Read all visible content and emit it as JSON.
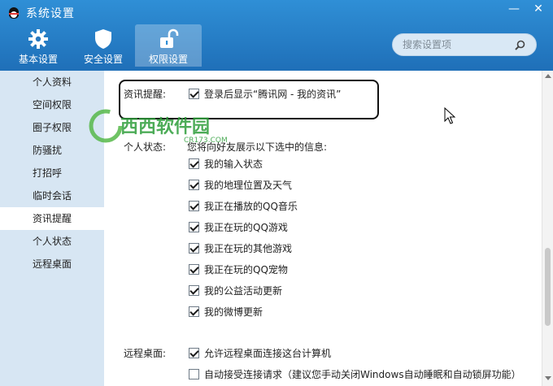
{
  "window": {
    "title": "系统设置",
    "min_glyph": "—",
    "close_glyph": "✕"
  },
  "tabs": [
    {
      "label": "基本设置",
      "icon": "gear-icon"
    },
    {
      "label": "安全设置",
      "icon": "shield-icon"
    },
    {
      "label": "权限设置",
      "icon": "unlock-icon",
      "active": true
    }
  ],
  "search": {
    "placeholder": "搜索设置项"
  },
  "sidebar": {
    "items": [
      {
        "label": "个人资料"
      },
      {
        "label": "空间权限"
      },
      {
        "label": "圈子权限"
      },
      {
        "label": "防骚扰"
      },
      {
        "label": "打招呼"
      },
      {
        "label": "临时会话"
      },
      {
        "label": "资讯提醒",
        "active": true
      },
      {
        "label": "个人状态"
      },
      {
        "label": "远程桌面"
      }
    ]
  },
  "news": {
    "label": "资讯提醒:",
    "option": {
      "text": "登录后显示“腾讯网 - 我的资讯”",
      "checked": true
    }
  },
  "status": {
    "label": "个人状态:",
    "intro": "您将向好友展示以下选中的信息:",
    "options": [
      {
        "text": "我的输入状态",
        "checked": true
      },
      {
        "text": "我的地理位置及天气",
        "checked": true
      },
      {
        "text": "我正在播放的QQ音乐",
        "checked": true
      },
      {
        "text": "我正在玩的QQ游戏",
        "checked": true
      },
      {
        "text": "我正在玩的其他游戏",
        "checked": true
      },
      {
        "text": "我正在玩的QQ宠物",
        "checked": true
      },
      {
        "text": "我的公益活动更新",
        "checked": true
      },
      {
        "text": "我的微博更新",
        "checked": true
      }
    ]
  },
  "remote": {
    "label": "远程桌面:",
    "options": [
      {
        "text": "允许远程桌面连接这台计算机",
        "checked": true
      },
      {
        "text": "自动接受连接请求（建议您手动关闭Windows自动睡眠和自动锁屏功能）",
        "checked": false
      }
    ]
  },
  "watermark": {
    "main": "西西软件园",
    "sub": "CR173.COM"
  },
  "colors": {
    "accent": "#2f8fd6",
    "sidebar": "#d7e6f3",
    "highlight_border": "#111111"
  }
}
